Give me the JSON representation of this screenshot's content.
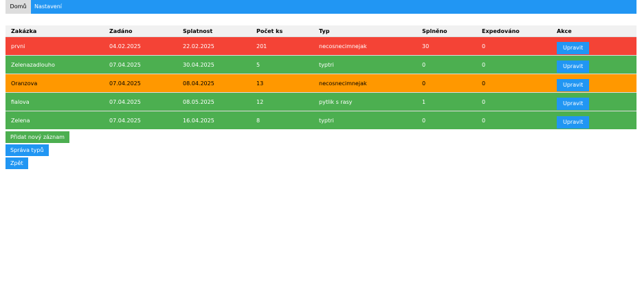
{
  "nav": {
    "home_label": "Domů",
    "settings_label": "Nastavení"
  },
  "table": {
    "headers": [
      "Zakázka",
      "Zadáno",
      "Splatnost",
      "Počet ks",
      "Typ",
      "Splněno",
      "Expedováno",
      "Akce"
    ],
    "rows": [
      {
        "name": "prvni",
        "assigned": "04.02.2025",
        "due": "22.02.2025",
        "count": "201",
        "type": "necosnecimnejak",
        "done": "30",
        "shipped": "0",
        "action": "Upravit",
        "status_color": "#f44336"
      },
      {
        "name": "Zelenazadlouho",
        "assigned": "07.04.2025",
        "due": "30.04.2025",
        "count": "5",
        "type": "typtri",
        "done": "0",
        "shipped": "0",
        "action": "Upravit",
        "status_color": "#4caf50"
      },
      {
        "name": "Oranzova",
        "assigned": "07.04.2025",
        "due": "08.04.2025",
        "count": "13",
        "type": "necosnecimnejak",
        "done": "0",
        "shipped": "0",
        "action": "Upravit",
        "status_color": "#ff9800"
      },
      {
        "name": "fialova",
        "assigned": "07.04.2025",
        "due": "08.05.2025",
        "count": "12",
        "type": "pytlik s rasy",
        "done": "1",
        "shipped": "0",
        "action": "Upravit",
        "status_color": "#4caf50"
      },
      {
        "name": "Zelena",
        "assigned": "07.04.2025",
        "due": "16.04.2025",
        "count": "8",
        "type": "typtri",
        "done": "0",
        "shipped": "0",
        "action": "Upravit",
        "status_color": "#4caf50"
      }
    ]
  },
  "actions": {
    "add_label": "Přidat nový záznam",
    "types_label": "Správa typů",
    "back_label": "Zpět"
  },
  "colors": {
    "primary": "#2196f3",
    "success": "#4caf50",
    "danger": "#f44336",
    "warning": "#ff9800"
  }
}
